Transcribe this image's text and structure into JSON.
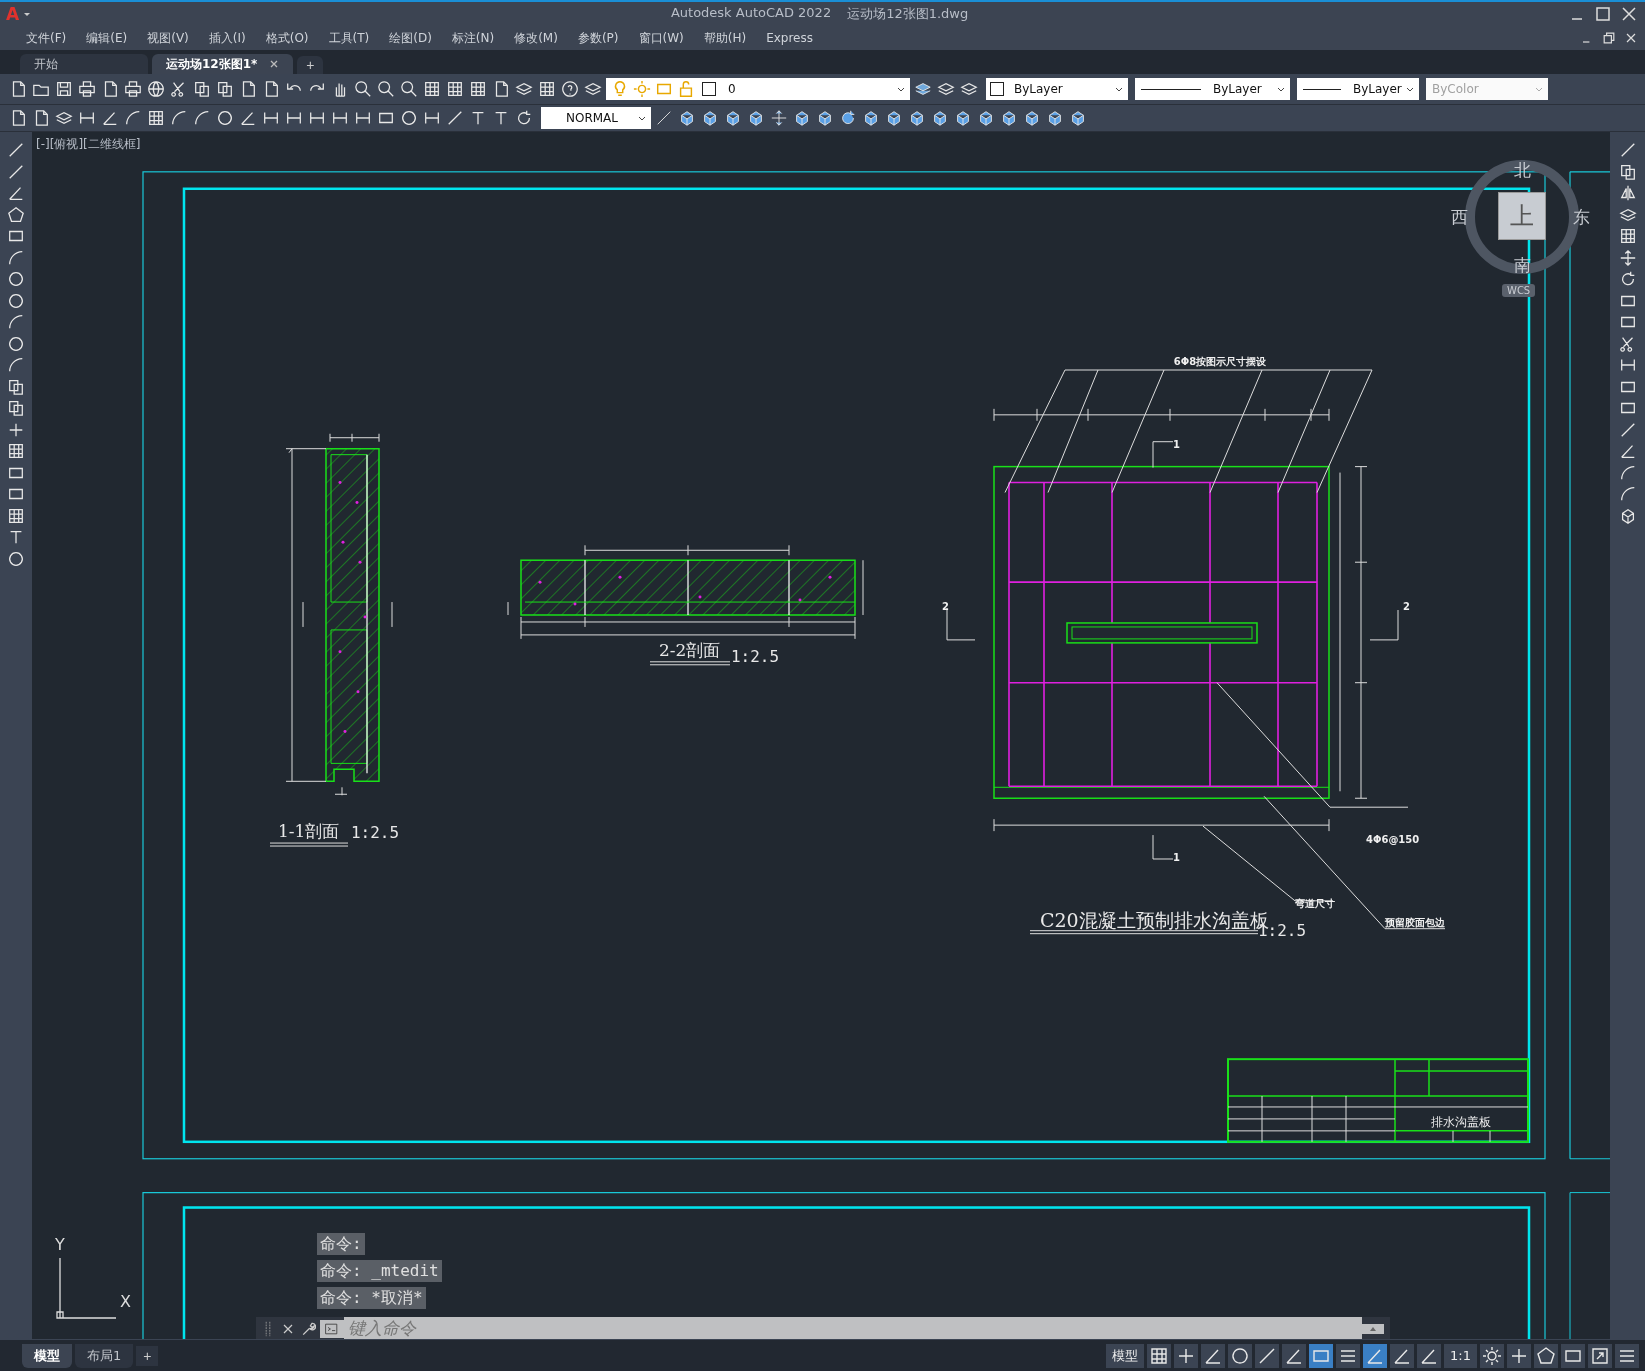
{
  "app": {
    "logo": "A",
    "title": "Autodesk AutoCAD 2022",
    "file": "运动场12张图1.dwg"
  },
  "menu": [
    "文件(F)",
    "编辑(E)",
    "视图(V)",
    "插入(I)",
    "格式(O)",
    "工具(T)",
    "绘图(D)",
    "标注(N)",
    "修改(M)",
    "参数(P)",
    "窗口(W)",
    "帮助(H)",
    "Express"
  ],
  "doc_tabs": [
    {
      "label": "开始",
      "selected": false
    },
    {
      "label": "运动场12张图1*",
      "selected": true
    }
  ],
  "new_tab": "+",
  "toolbar": {
    "layer": "0",
    "color_control": "ByLayer",
    "linetype": "ByLayer",
    "lineweight": "ByLayer",
    "plotstyle": "ByColor",
    "textstyle": "NORMAL"
  },
  "viewport_label": "[-][俯视][二维线框]",
  "viewcube": {
    "north": "北",
    "south": "南",
    "east": "东",
    "west": "西",
    "face": "上",
    "wcs": "WCS"
  },
  "drawing": {
    "sections": [
      {
        "title": "1-1剖面",
        "scale": "1:2.5"
      },
      {
        "title": "2-2剖面",
        "scale": "1:2.5"
      },
      {
        "title": "C20混凝土预制排水沟盖板",
        "scale": "1:2.5"
      }
    ],
    "notes": [
      "6Φ8按图示尺寸摆设",
      "4Φ6@150",
      "弯道尺寸",
      "预留胶面包边"
    ],
    "section_marks": [
      "1",
      "1",
      "2",
      "2"
    ]
  },
  "title_block": {
    "drawing_name": "排水沟盖板"
  },
  "command": {
    "history": [
      "命令:",
      "命令: _mtedit",
      "命令: *取消*"
    ],
    "placeholder": "键入命令"
  },
  "ucs": {
    "y": "Y",
    "x": "X"
  },
  "layout_tabs": [
    {
      "label": "模型",
      "selected": true
    },
    {
      "label": "布局1",
      "selected": false
    }
  ],
  "new_layout": "+",
  "status": {
    "space": "模型",
    "scale": "1:1"
  }
}
